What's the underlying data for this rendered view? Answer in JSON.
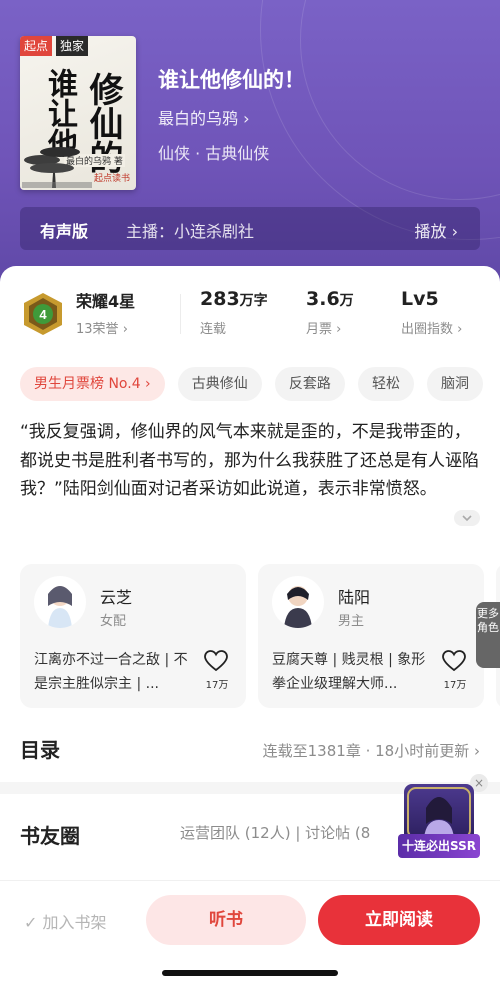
{
  "header": {
    "cover_tags": [
      "起点",
      "独家"
    ],
    "cover_title_calligraphy": [
      "谁让他",
      "修仙的"
    ],
    "cover_subtitle": "最白的乌鸦 著",
    "cover_publisher": "起点读书",
    "title": "谁让他修仙的！",
    "author": "最白的乌鸦",
    "genre": "仙侠 · 古典仙侠",
    "audio": {
      "label": "有声版",
      "host": "主播：小连杀剧社",
      "play": "播放"
    }
  },
  "stats": {
    "honor_title": "荣耀4星",
    "honor_level": "4",
    "honor_sub": "13荣誉",
    "items": [
      {
        "value": "283",
        "unit": "万字",
        "label": "连载"
      },
      {
        "value": "3.6",
        "unit": "万",
        "label": "月票"
      },
      {
        "value": "Lv5",
        "unit": "",
        "label": "出圈指数"
      }
    ]
  },
  "tags": [
    "男生月票榜 No.4",
    "古典修仙",
    "反套路",
    "轻松",
    "脑洞"
  ],
  "intro": "“我反复强调，修仙界的风气本来就是歪的，不是我带歪的，都说史书是胜利者书写的，那为什么我获胜了还总是有人诬陷我？”陆阳剑仙面对记者采访如此说道，表示非常愤怒。",
  "characters": [
    {
      "name": "云芝",
      "role": "女配",
      "desc": "江离亦不过一合之敌 | 不是宗主胜似宗主 | ...",
      "likes": "17万"
    },
    {
      "name": "陆阳",
      "role": "男主",
      "desc": "豆腐天尊 | 贱灵根 | 象形拳企业级理解大师...",
      "likes": "17万"
    }
  ],
  "more_characters": "更多角色",
  "toc": {
    "title": "目录",
    "status": "连载至1381章 · 18小时前更新"
  },
  "forum": {
    "title": "书友圈",
    "status": "运营团队 (12人) | 讨论帖 (8"
  },
  "promo": {
    "label": "十连必出SSR",
    "close": "×"
  },
  "bottom": {
    "shelf": "加入书架",
    "listen": "听书",
    "read": "立即阅读"
  },
  "colors": {
    "hero": "#6f54b8",
    "accent": "#e8323a",
    "accent_soft": "#fde6e6"
  }
}
